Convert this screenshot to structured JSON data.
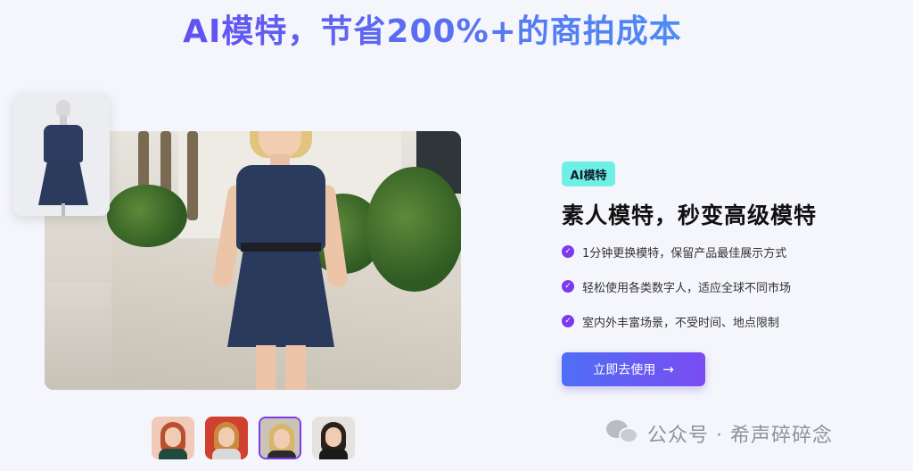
{
  "headline": "AI模特，节省200%+的商拍成本",
  "feature_panel": {
    "tag": "AI模特",
    "title": "素人模特，秒变高级模特",
    "features": [
      "1分钟更换模特，保留产品最佳展示方式",
      "轻松使用各类数字人，适应全球不同市场",
      "室内外丰富场景，不受时间、地点限制"
    ],
    "cta_label": "立即去使用",
    "cta_icon": "arrow-right-icon"
  },
  "avatars": [
    {
      "hair": "#b8502e",
      "bg": "#f0c9b8",
      "body": "#1f4a3e",
      "selected": false
    },
    {
      "hair": "#c98a3f",
      "bg": "#d0402e",
      "body": "#d9d9d9",
      "selected": false
    },
    {
      "hair": "#d8b56a",
      "bg": "#c9c4b5",
      "body": "#2a2a2a",
      "selected": true
    },
    {
      "hair": "#2a211c",
      "bg": "#e6e3df",
      "body": "#1a1a1a",
      "selected": false
    }
  ],
  "watermark": "公众号 · 希声碎碎念",
  "colors": {
    "accent": "#7c3aed",
    "tag_bg": "#6ff0e6",
    "cta_gradient_start": "#4f6ef5",
    "cta_gradient_end": "#7a4cf2"
  }
}
